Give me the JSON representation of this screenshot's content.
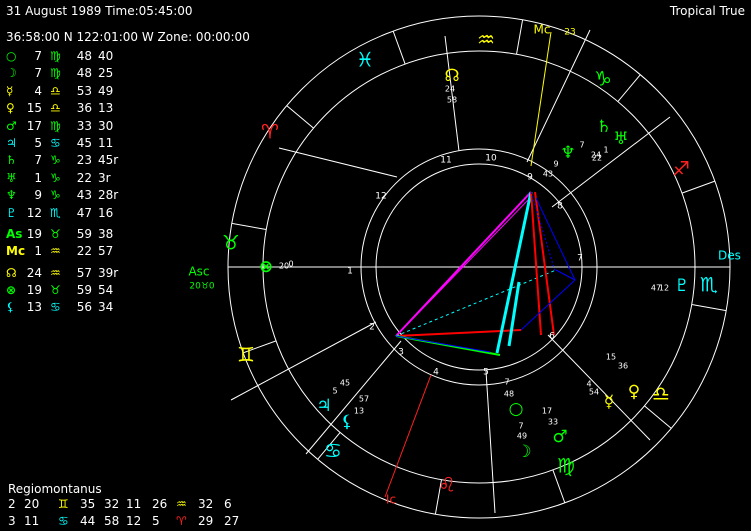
{
  "header": {
    "date_time": "31 August 1989 Time:05:45:00",
    "location": "36:58:00 N 122:01:00 W Zone: 00:00:00",
    "zodiac": "Tropical True"
  },
  "colors": {
    "fire": "#ff2020",
    "earth": "#00ff00",
    "air": "#ffff00",
    "water": "#00ffff",
    "aspect_red": "#ff0000",
    "aspect_blue": "#0000ff",
    "aspect_magenta": "#ff00ff",
    "aspect_cyan": "#00ffff",
    "aspect_green": "#00ff00"
  },
  "planets": [
    {
      "glyph": "○",
      "icon": "sun-icon",
      "color": "#00ff00",
      "deg": "7",
      "sign": "♍",
      "sign_color": "#00ff00",
      "min": "48",
      "sec": "40"
    },
    {
      "glyph": "☽",
      "icon": "moon-icon",
      "color": "#00ff00",
      "deg": "7",
      "sign": "♍",
      "sign_color": "#00ff00",
      "min": "48",
      "sec": "25"
    },
    {
      "glyph": "☿",
      "icon": "mercury-icon",
      "color": "#ffff00",
      "deg": "4",
      "sign": "♎",
      "sign_color": "#ffff00",
      "min": "53",
      "sec": "49"
    },
    {
      "glyph": "♀",
      "icon": "venus-icon",
      "color": "#ffff00",
      "deg": "15",
      "sign": "♎",
      "sign_color": "#ffff00",
      "min": "36",
      "sec": "13"
    },
    {
      "glyph": "♂",
      "icon": "mars-icon",
      "color": "#00ff00",
      "deg": "17",
      "sign": "♍",
      "sign_color": "#00ff00",
      "min": "33",
      "sec": "30"
    },
    {
      "glyph": "♃",
      "icon": "jupiter-icon",
      "color": "#00ffff",
      "deg": "5",
      "sign": "♋",
      "sign_color": "#00ffff",
      "min": "45",
      "sec": "11"
    },
    {
      "glyph": "♄",
      "icon": "saturn-icon",
      "color": "#00ff00",
      "deg": "7",
      "sign": "♑",
      "sign_color": "#00ff00",
      "min": "23",
      "sec": "45r"
    },
    {
      "glyph": "♅",
      "icon": "uranus-icon",
      "color": "#00ff00",
      "deg": "1",
      "sign": "♑",
      "sign_color": "#00ff00",
      "min": "22",
      "sec": "3r"
    },
    {
      "glyph": "♆",
      "icon": "neptune-icon",
      "color": "#00ff00",
      "deg": "9",
      "sign": "♑",
      "sign_color": "#00ff00",
      "min": "43",
      "sec": "28r"
    },
    {
      "glyph": "♇",
      "icon": "pluto-icon",
      "color": "#00ffff",
      "deg": "12",
      "sign": "♏",
      "sign_color": "#00ffff",
      "min": "47",
      "sec": "16"
    }
  ],
  "angles": [
    {
      "glyph": "As",
      "icon": "ascendant-label",
      "color": "#00ff00",
      "deg": "19",
      "sign": "♉",
      "sign_color": "#00ff00",
      "min": "59",
      "sec": "38"
    },
    {
      "glyph": "Mc",
      "icon": "midheaven-label",
      "color": "#ffff00",
      "deg": "1",
      "sign": "♒",
      "sign_color": "#ffff00",
      "min": "22",
      "sec": "57"
    }
  ],
  "points": [
    {
      "glyph": "☊",
      "icon": "north-node-icon",
      "color": "#ffff00",
      "deg": "24",
      "sign": "♒",
      "sign_color": "#ffff00",
      "min": "57",
      "sec": "39r"
    },
    {
      "glyph": "⊗",
      "icon": "part-of-fortune-icon",
      "color": "#00ff00",
      "deg": "19",
      "sign": "♉",
      "sign_color": "#00ff00",
      "min": "59",
      "sec": "54"
    },
    {
      "glyph": "⚸",
      "icon": "lilith-icon",
      "color": "#00ffff",
      "deg": "13",
      "sign": "♋",
      "sign_color": "#00ffff",
      "min": "56",
      "sec": "34"
    }
  ],
  "house_system": "Regiomontanus",
  "cusps": [
    {
      "h1": "2",
      "d1": "20",
      "s1": "♊",
      "c1": "#ffff00",
      "m1": "35",
      "sec1": "32",
      "h2": "11",
      "d2": "26",
      "s2": "♒",
      "c2": "#ffff00",
      "m2": "32",
      "sec2": "6"
    },
    {
      "h1": "3",
      "d1": "11",
      "s1": "♋",
      "c1": "#00ffff",
      "m1": "44",
      "sec1": "58",
      "h2": "12",
      "d2": "5",
      "s2": "♈",
      "c2": "#ff2020",
      "m2": "29",
      "sec2": "27"
    }
  ],
  "wheel": {
    "asc_label": "Asc",
    "asc_value": "20♉0",
    "des_label": "Des",
    "mc_label": "Mc",
    "mc_value": "23",
    "ic_label": "Ic",
    "house_numbers": [
      "1",
      "2",
      "3",
      "4",
      "5",
      "6",
      "7",
      "8",
      "9",
      "10",
      "11",
      "12"
    ],
    "signs": [
      {
        "glyph": "♉",
        "name": "taurus-icon",
        "color": "#00ff00"
      },
      {
        "glyph": "♈",
        "name": "aries-icon",
        "color": "#ff2020"
      },
      {
        "glyph": "♓",
        "name": "pisces-icon",
        "color": "#00ffff"
      },
      {
        "glyph": "♒",
        "name": "aquarius-icon",
        "color": "#ffff00"
      },
      {
        "glyph": "♑",
        "name": "capricorn-icon",
        "color": "#00ff00"
      },
      {
        "glyph": "♐",
        "name": "sagittarius-icon",
        "color": "#ff2020"
      },
      {
        "glyph": "♏",
        "name": "scorpio-icon",
        "color": "#00ffff"
      },
      {
        "glyph": "♎",
        "name": "libra-icon",
        "color": "#ffff00"
      },
      {
        "glyph": "♍",
        "name": "virgo-icon",
        "color": "#00ff00"
      },
      {
        "glyph": "♌",
        "name": "leo-icon",
        "color": "#ff2020"
      },
      {
        "glyph": "♋",
        "name": "cancer-icon",
        "color": "#00ffff"
      },
      {
        "glyph": "♊",
        "name": "gemini-icon",
        "color": "#ffff00"
      }
    ],
    "planet_marks": [
      {
        "glyph": "☊",
        "name": "north-node-wheel-icon",
        "color": "#ffff00",
        "deg": "24",
        "min": "58"
      },
      {
        "glyph": "♆",
        "name": "neptune-wheel-icon",
        "color": "#00ff00",
        "deg": "9",
        "min": "43"
      },
      {
        "glyph": "♄",
        "name": "saturn-wheel-icon",
        "color": "#00ff00",
        "deg": "7",
        "min": "24"
      },
      {
        "glyph": "♅",
        "name": "uranus-wheel-icon",
        "color": "#00ff00",
        "deg": "1",
        "min": "22"
      },
      {
        "glyph": "♇",
        "name": "pluto-wheel-icon",
        "color": "#00ffff",
        "deg": "12",
        "min": "47"
      },
      {
        "glyph": "♀",
        "name": "venus-wheel-icon",
        "color": "#ffff00",
        "deg": "15",
        "min": "36"
      },
      {
        "glyph": "☿",
        "name": "mercury-wheel-icon",
        "color": "#ffff00",
        "deg": "4",
        "min": "54"
      },
      {
        "glyph": "♂",
        "name": "mars-wheel-icon",
        "color": "#00ff00",
        "deg": "17",
        "min": "33"
      },
      {
        "glyph": "○",
        "name": "sun-wheel-icon",
        "color": "#00ff00",
        "deg": "7",
        "min": "48"
      },
      {
        "glyph": "☽",
        "name": "moon-wheel-icon",
        "color": "#00ff00",
        "deg": "7",
        "min": "49"
      },
      {
        "glyph": "♃",
        "name": "jupiter-wheel-icon",
        "color": "#00ffff",
        "deg": "5",
        "min": "45"
      },
      {
        "glyph": "⚸",
        "name": "lilith-wheel-icon",
        "color": "#00ffff",
        "deg": "13",
        "min": "57"
      },
      {
        "glyph": "⊗",
        "name": "fortune-wheel-icon",
        "color": "#00ff00",
        "deg": "20",
        "min": "0"
      }
    ]
  }
}
